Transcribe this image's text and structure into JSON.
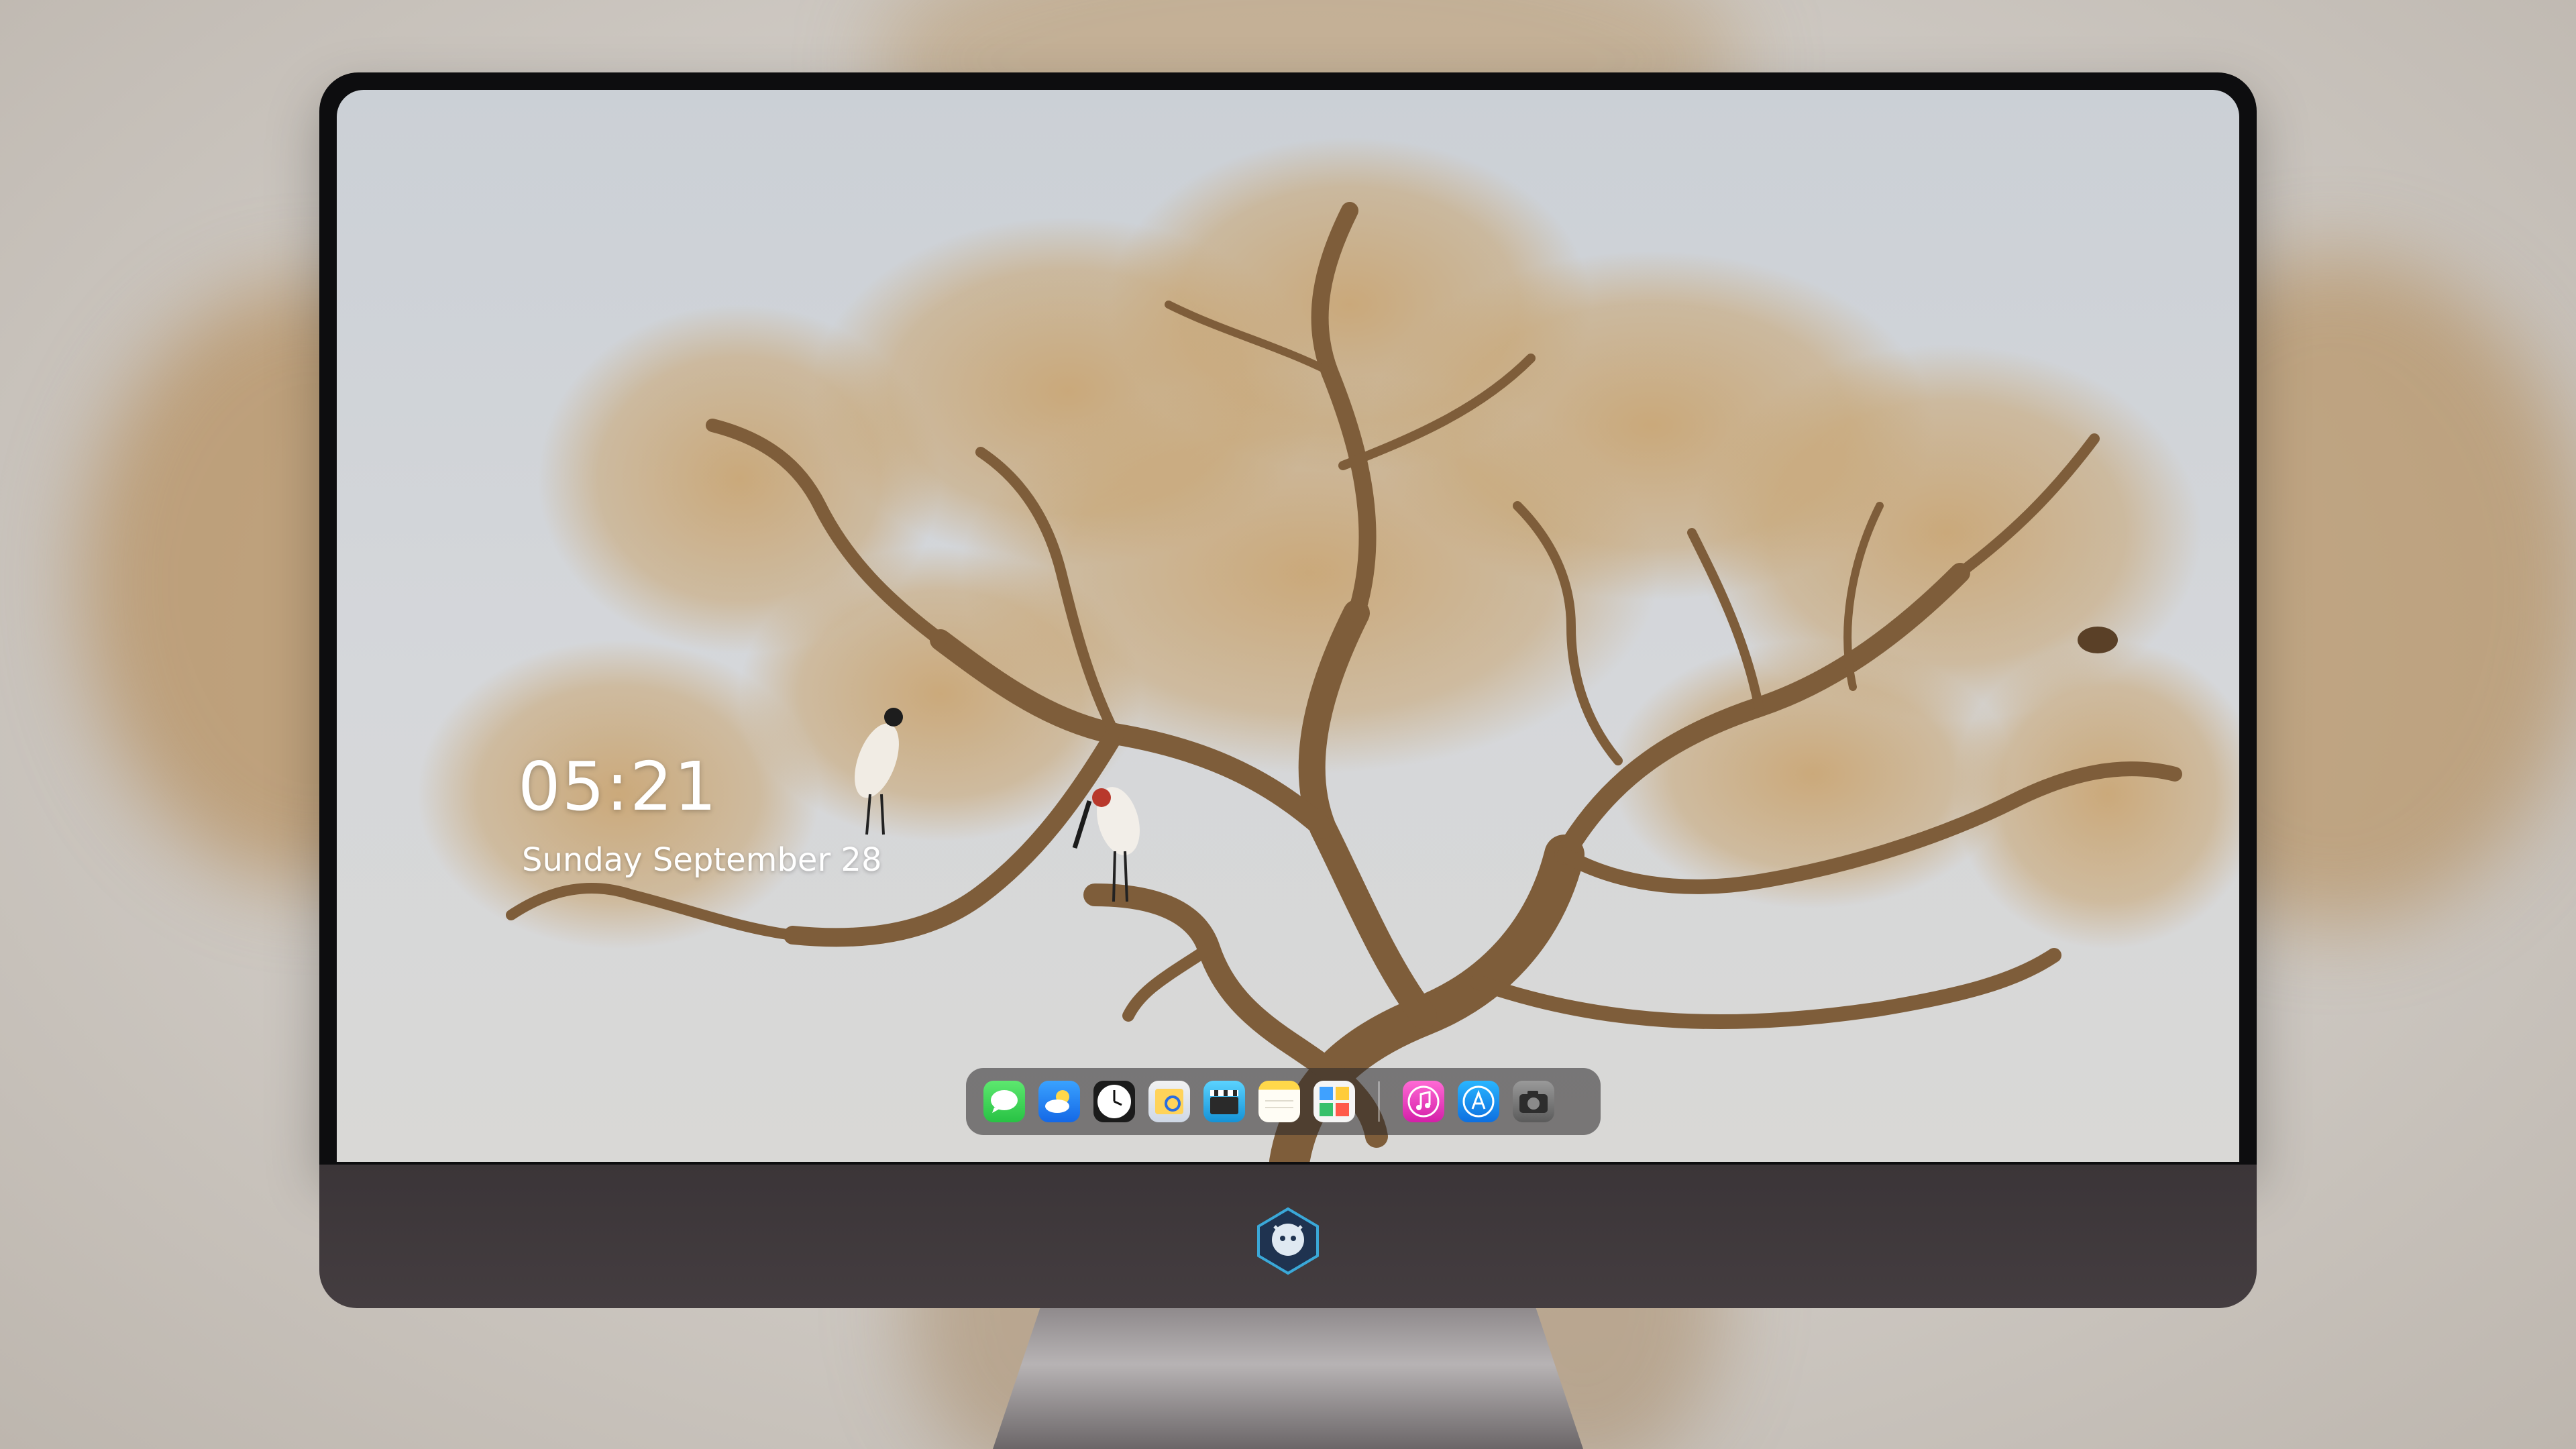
{
  "lock_screen": {
    "time": "05:21",
    "date": "Sunday September 28"
  },
  "dock": {
    "apps": [
      "messages-icon",
      "weather-icon",
      "clock-icon",
      "preview-icon",
      "video-editor-icon",
      "notes-icon",
      "photos-icon"
    ],
    "pinned": [
      "music-icon",
      "app-store-icon",
      "camera-icon"
    ]
  },
  "colors": {
    "dock_background": "#28262b",
    "chin": "#3f393c",
    "bezel": "#0d0d0f",
    "tree_bark": "#8a6a44",
    "tree_foliage": "#c8a470",
    "messages": "#34c759",
    "weather": "#1e8fff",
    "music": "#ff3fbf",
    "app_store": "#1c7cf4"
  }
}
